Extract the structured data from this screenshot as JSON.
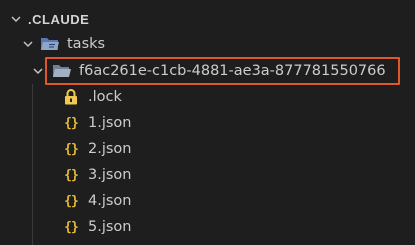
{
  "explorer": {
    "section_title": ".CLAUDE",
    "tasks_folder": "tasks",
    "task_folder": "f6ac261e-c1cb-4881-ae3a-877781550766",
    "files": [
      {
        "name": ".lock",
        "icon": "lock-icon"
      },
      {
        "name": "1.json",
        "icon": "json-icon"
      },
      {
        "name": "2.json",
        "icon": "json-icon"
      },
      {
        "name": "3.json",
        "icon": "json-icon"
      },
      {
        "name": "4.json",
        "icon": "json-icon"
      },
      {
        "name": "5.json",
        "icon": "json-icon"
      }
    ],
    "json_glyph": "{}",
    "colors": {
      "background": "#1e1e1e",
      "text": "#cccccc",
      "highlight_border": "#e0572c",
      "json_icon": "#e2b93b",
      "lock_icon": "#f2c94c",
      "folder_icon": "#8fa6c9"
    }
  }
}
